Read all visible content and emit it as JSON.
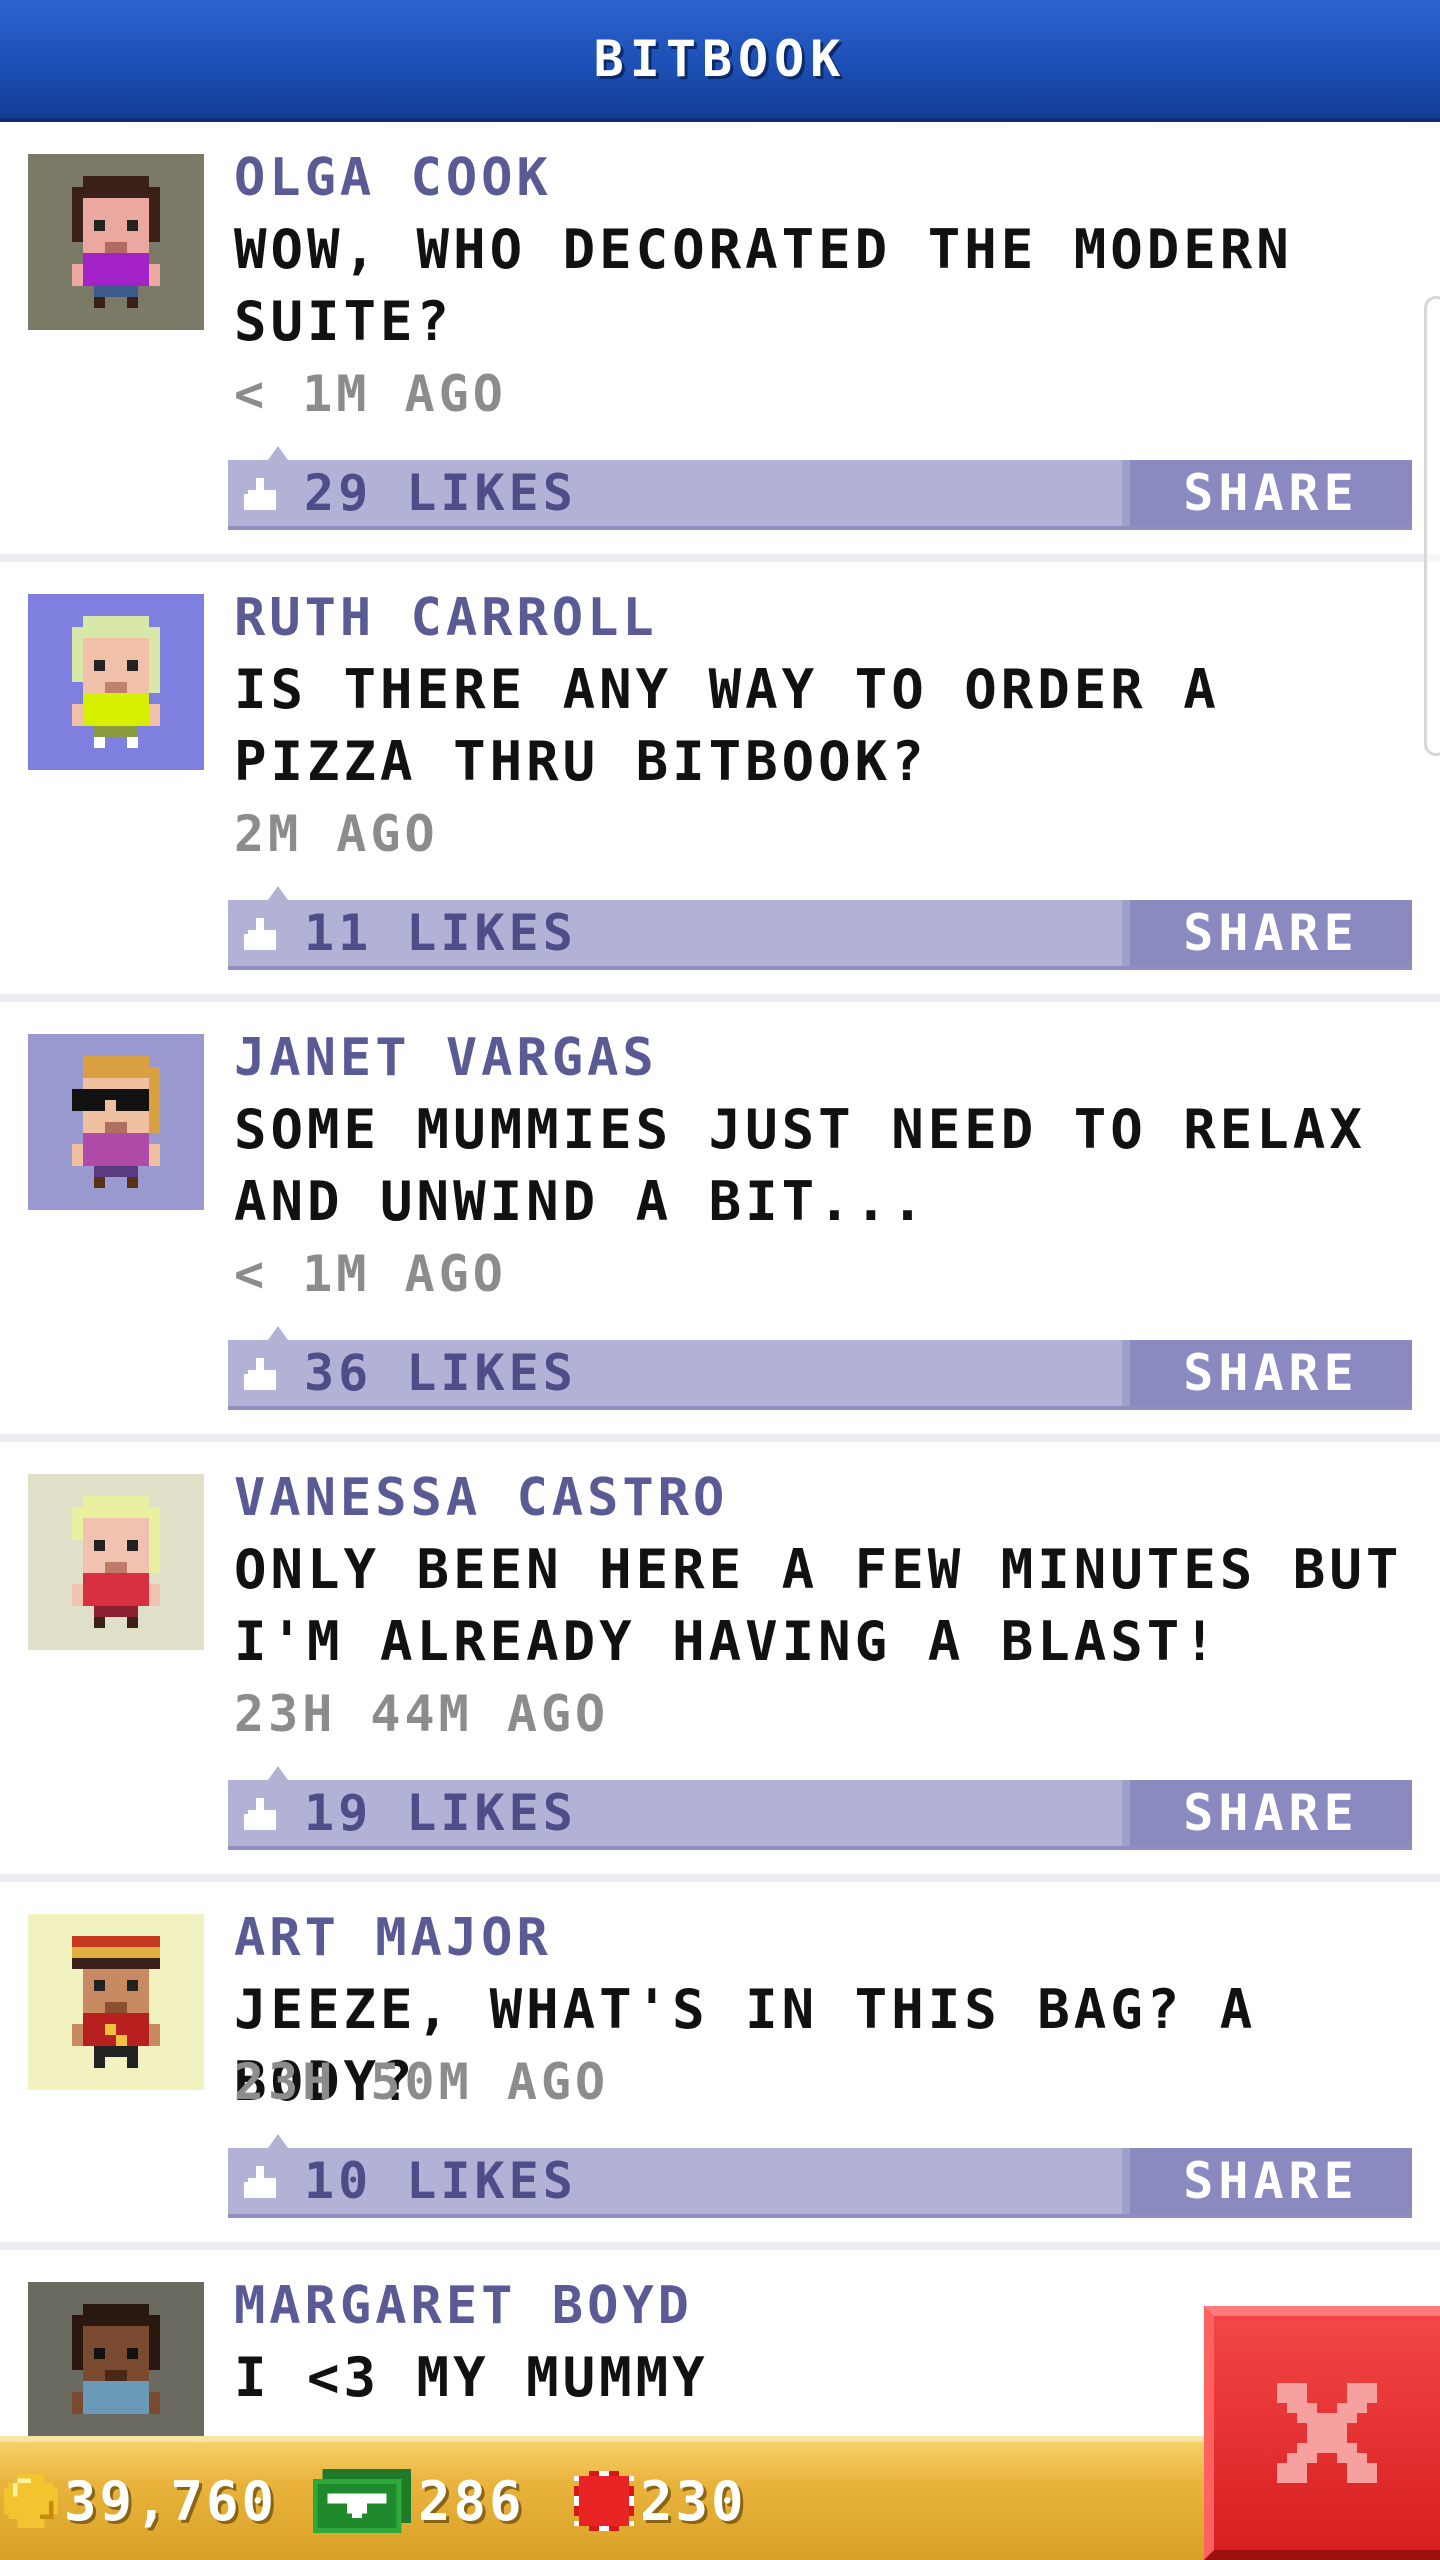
{
  "header": {
    "title": "BITBOOK"
  },
  "feed": {
    "posts": [
      {
        "author": "OLGA COOK",
        "message": "WOW, WHO DECORATED THE MODERN SUITE?",
        "time": "< 1M AGO",
        "likes": "29 LIKES",
        "share_label": "SHARE"
      },
      {
        "author": "RUTH CARROLL",
        "message": "IS THERE ANY WAY TO ORDER A PIZZA THRU BITBOOK?",
        "time": "2M AGO",
        "likes": "11 LIKES",
        "share_label": "SHARE"
      },
      {
        "author": "JANET VARGAS",
        "message": "SOME MUMMIES JUST NEED TO RELAX AND UNWIND A BIT...",
        "time": "< 1M AGO",
        "likes": "36 LIKES",
        "share_label": "SHARE"
      },
      {
        "author": "VANESSA CASTRO",
        "message": "ONLY BEEN HERE A FEW MINUTES BUT I'M ALREADY HAVING A BLAST!",
        "time": "23H 44M AGO",
        "likes": "19 LIKES",
        "share_label": "SHARE"
      },
      {
        "author": "ART MAJOR",
        "message": "JEEZE, WHAT'S IN THIS BAG? A BODY?",
        "time": "23H 50M AGO",
        "likes": "10 LIKES",
        "share_label": "SHARE"
      },
      {
        "author": "MARGARET BOYD",
        "message": "I <3 MY MUMMY"
      }
    ]
  },
  "bottom_bar": {
    "coins": "39,760",
    "bux": "286",
    "tickets": "230"
  },
  "icons": {
    "coin": "coin-icon",
    "bux": "bux-icon",
    "ticket": "ticket-icon",
    "like": "like-icon",
    "close": "close-icon"
  },
  "colors": {
    "header": "#1d4fb5",
    "action_bar": "#b2b2d6",
    "share_button": "#8a8ac0",
    "bottom_bar": "#e9b33c",
    "close_button": "#e02a2a"
  }
}
